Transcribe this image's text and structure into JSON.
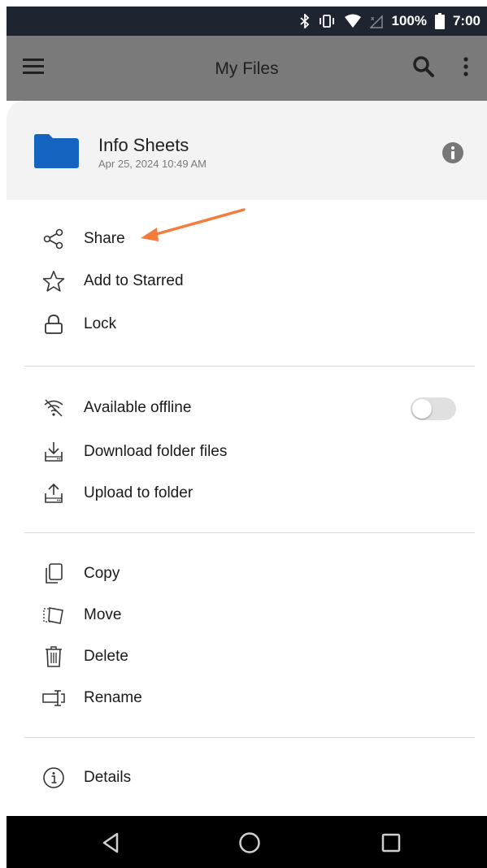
{
  "status_bar": {
    "battery_text": "100%",
    "time": "7:00"
  },
  "app_bar": {
    "title": "My Files"
  },
  "folder": {
    "name": "Info Sheets",
    "date": "Apr 25, 2024 10:49 AM",
    "color": "#1565c0"
  },
  "menu": {
    "share": "Share",
    "add_starred": "Add to Starred",
    "lock": "Lock",
    "available_offline": "Available offline",
    "available_offline_on": false,
    "download_folder": "Download folder files",
    "upload_folder": "Upload to folder",
    "copy": "Copy",
    "move": "Move",
    "delete": "Delete",
    "rename": "Rename",
    "details": "Details"
  },
  "annotation_color": "#f47c3c"
}
